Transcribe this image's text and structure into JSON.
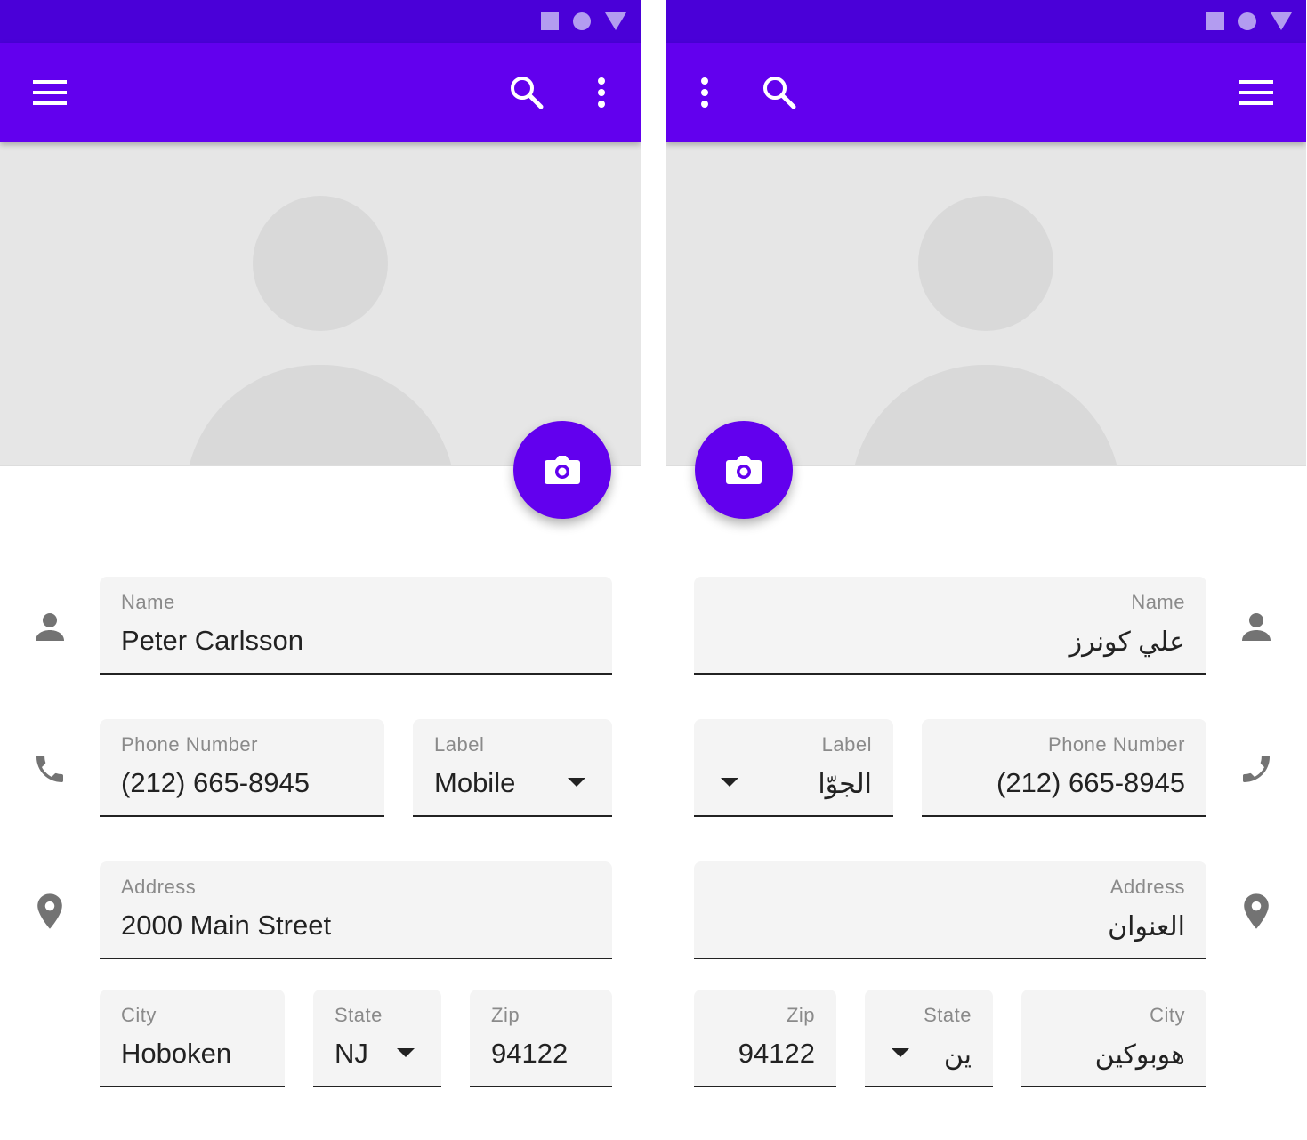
{
  "colors": {
    "primary": "#6200ee",
    "status_bar": "#4a00d8",
    "hero_bg": "#e6e6e6",
    "field_bg": "#f4f4f4",
    "icon_gray": "#737373"
  },
  "status_icons": [
    "square-icon",
    "circle-icon",
    "triangle-icon"
  ],
  "ltr": {
    "toolbar_icons": [
      "menu-icon",
      "search-icon",
      "more-vert-icon"
    ],
    "fields": {
      "name": {
        "label": "Name",
        "value": "Peter Carlsson"
      },
      "phone": {
        "label": "Phone Number",
        "value": "(212) 665-8945"
      },
      "phone_label": {
        "label": "Label",
        "value": "Mobile"
      },
      "address": {
        "label": "Address",
        "value": "2000 Main Street"
      },
      "city": {
        "label": "City",
        "value": "Hoboken"
      },
      "state": {
        "label": "State",
        "value": "NJ"
      },
      "zip": {
        "label": "Zip",
        "value": "94122"
      }
    }
  },
  "rtl": {
    "toolbar_icons": [
      "more-vert-icon",
      "search-icon",
      "menu-icon"
    ],
    "fields": {
      "name": {
        "label": "Name",
        "value": "علي كونرز"
      },
      "phone": {
        "label": "Phone Number",
        "value": "(212) 665-8945"
      },
      "phone_label": {
        "label": "Label",
        "value": "الجوّا"
      },
      "address": {
        "label": "Address",
        "value": "العنوان"
      },
      "city": {
        "label": "City",
        "value": "هوبوكين"
      },
      "state": {
        "label": "State",
        "value": "ين"
      },
      "zip": {
        "label": "Zip",
        "value": "94122"
      }
    }
  }
}
